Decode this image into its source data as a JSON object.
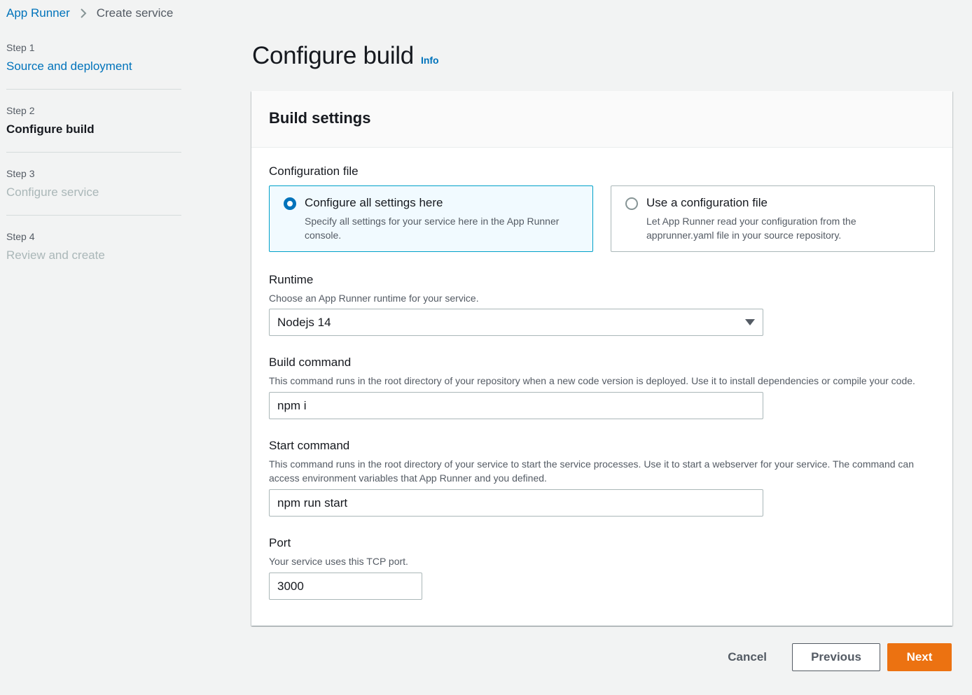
{
  "breadcrumb": {
    "root": "App Runner",
    "current": "Create service"
  },
  "steps": [
    {
      "num": "Step 1",
      "title": "Source and deployment",
      "state": "link"
    },
    {
      "num": "Step 2",
      "title": "Configure build",
      "state": "active"
    },
    {
      "num": "Step 3",
      "title": "Configure service",
      "state": "disabled"
    },
    {
      "num": "Step 4",
      "title": "Review and create",
      "state": "disabled"
    }
  ],
  "page": {
    "title": "Configure build",
    "info": "Info"
  },
  "panel": {
    "title": "Build settings"
  },
  "config_file": {
    "label": "Configuration file",
    "options": [
      {
        "title": "Configure all settings here",
        "desc": "Specify all settings for your service here in the App Runner console.",
        "selected": true
      },
      {
        "title": "Use a configuration file",
        "desc": "Let App Runner read your configuration from the apprunner.yaml file in your source repository.",
        "selected": false
      }
    ]
  },
  "runtime": {
    "label": "Runtime",
    "desc": "Choose an App Runner runtime for your service.",
    "value": "Nodejs 14"
  },
  "build_command": {
    "label": "Build command",
    "desc": "This command runs in the root directory of your repository when a new code version is deployed. Use it to install dependencies or compile your code.",
    "value": "npm i"
  },
  "start_command": {
    "label": "Start command",
    "desc": "This command runs in the root directory of your service to start the service processes. Use it to start a webserver for your service. The command can access environment variables that App Runner and you defined.",
    "value": "npm run start"
  },
  "port": {
    "label": "Port",
    "desc": "Your service uses this TCP port.",
    "value": "3000"
  },
  "actions": {
    "cancel": "Cancel",
    "previous": "Previous",
    "next": "Next"
  },
  "colors": {
    "accent": "#0073bb",
    "primary_button": "#ec7211",
    "selected_tile_bg": "#f1faff",
    "selected_tile_border": "#00a1c9"
  }
}
